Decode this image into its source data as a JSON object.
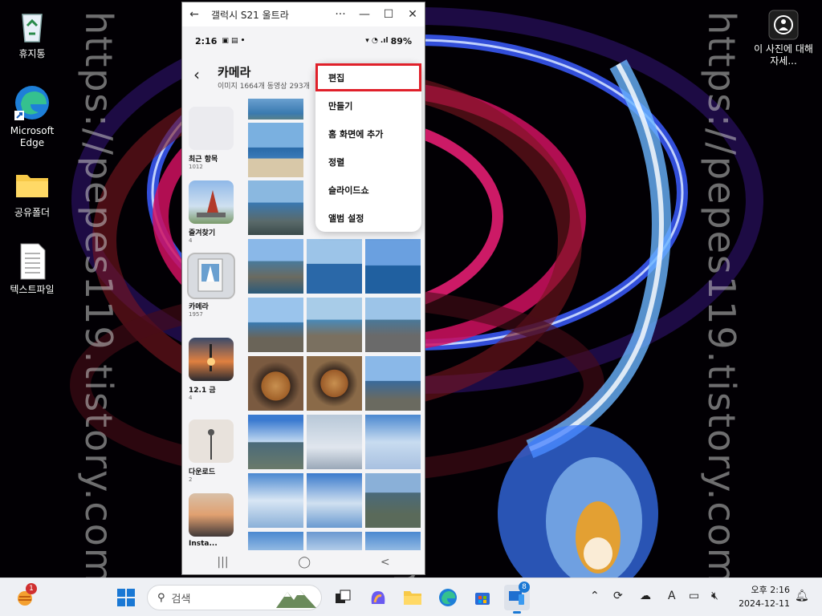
{
  "desktop": {
    "icons": [
      {
        "label": "휴지통",
        "icon": "recycle-bin-icon"
      },
      {
        "label": "Microsoft Edge",
        "icon": "edge-icon"
      },
      {
        "label": "공유폴더",
        "icon": "folder-icon"
      },
      {
        "label": "텍스트파일",
        "icon": "text-file-icon"
      }
    ],
    "right_icon": {
      "label": "이 사진에 대해 자세...",
      "icon": "learn-about-picture-icon"
    },
    "watermark": "https://pepes119.tistory.com/"
  },
  "phone_window": {
    "title": "갤럭시 S21 울트라",
    "controls": {
      "back": "←",
      "more": "···",
      "minimize": "—",
      "maximize": "☐",
      "close": "✕"
    },
    "status": {
      "time": "2:16",
      "battery": "89%"
    },
    "album": {
      "title": "카메라",
      "subtitle": "이미지 1664개 동영상 293개"
    },
    "albums": [
      {
        "name": "최근 항목",
        "count": "1012"
      },
      {
        "name": "즐겨찾기",
        "count": "4"
      },
      {
        "name": "카메라",
        "count": "1957"
      },
      {
        "name": "12.1 금",
        "count": "4"
      },
      {
        "name": "다운로드",
        "count": "2"
      },
      {
        "name": "Insta...",
        "count": ""
      }
    ],
    "menu": [
      {
        "label": "편집",
        "highlighted": true
      },
      {
        "label": "만들기"
      },
      {
        "label": "홈 화면에 추가"
      },
      {
        "label": "정렬"
      },
      {
        "label": "슬라이드쇼"
      },
      {
        "label": "앨범 설정"
      }
    ],
    "nav": {
      "recents": "|||",
      "home": "◯",
      "back": "<"
    }
  },
  "taskbar": {
    "search_placeholder": "검색",
    "weather_badge": "1",
    "store_badge": "8",
    "clock": {
      "time": "오후 2:16",
      "date": "2024-12-11"
    },
    "tray_ime": "A"
  },
  "colors": {
    "highlight": "#e0202a",
    "taskbar": "#eef0f4"
  }
}
